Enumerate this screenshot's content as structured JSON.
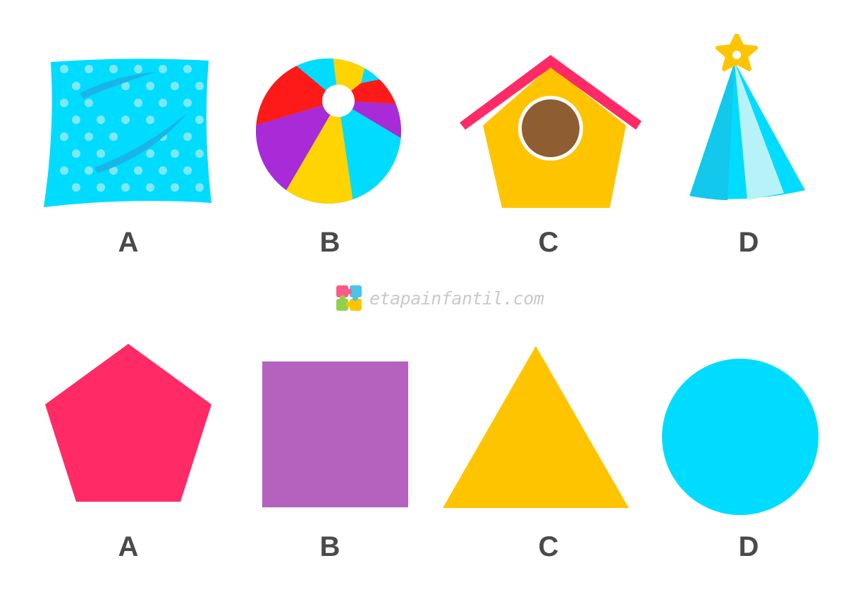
{
  "top_row": {
    "items": [
      {
        "label": "A",
        "object": "pillow"
      },
      {
        "label": "B",
        "object": "beach-ball"
      },
      {
        "label": "C",
        "object": "birdhouse"
      },
      {
        "label": "D",
        "object": "party-hat"
      }
    ]
  },
  "watermark": {
    "text": "etapainfantil.com",
    "icon": "puzzle-logo-icon"
  },
  "bottom_row": {
    "items": [
      {
        "label": "A",
        "shape": "pentagon",
        "color": "#ff2a66"
      },
      {
        "label": "B",
        "shape": "square",
        "color": "#b462bd"
      },
      {
        "label": "C",
        "shape": "triangle",
        "color": "#ffc400"
      },
      {
        "label": "D",
        "shape": "circle",
        "color": "#00dcff"
      }
    ]
  },
  "colors": {
    "cyan": "#00dcff",
    "pink": "#ff2a66",
    "yellow": "#ffc400",
    "purple": "#b462bd",
    "red": "#ff1a1a",
    "violet": "#a92bd8",
    "brown": "#8f5d32",
    "label": "#4a4a4a"
  }
}
